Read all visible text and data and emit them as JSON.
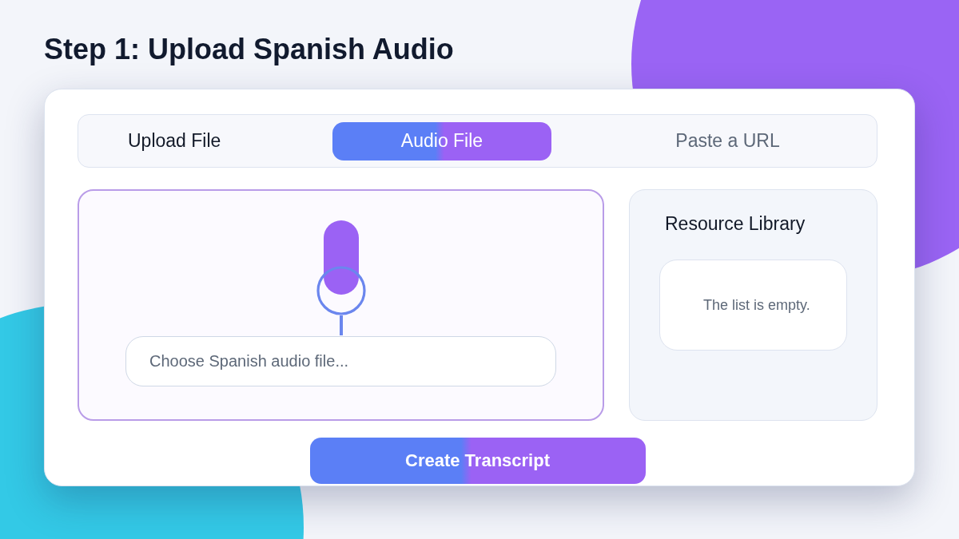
{
  "heading": "Step 1: Upload Spanish Audio",
  "source_bar": {
    "label": "Upload File",
    "tabs": [
      {
        "label": "Audio File",
        "selected": true
      },
      {
        "label": "Paste a URL",
        "selected": false
      }
    ]
  },
  "upload_area": {
    "file_field": {
      "placeholder": "Choose Spanish audio file..."
    }
  },
  "resource_library": {
    "title": "Resource Library",
    "empty_message": "The list is empty."
  },
  "primary_button": "Create Transcript"
}
